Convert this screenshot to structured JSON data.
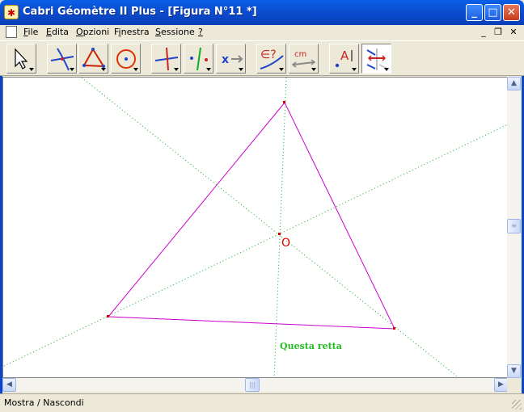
{
  "window": {
    "title": "Cabri Géomètre II Plus - [Figura N°11 *]",
    "app_icon": "cabri-icon",
    "controls": {
      "minimize": "_",
      "maximize": "□",
      "close": "✕"
    }
  },
  "menu": {
    "items": [
      {
        "label": "File",
        "underline": "F"
      },
      {
        "label": "Edita",
        "underline": "E"
      },
      {
        "label": "Opzioni",
        "underline": "O"
      },
      {
        "label": "Finestra",
        "underline": "i"
      },
      {
        "label": "Sessione",
        "underline": "S"
      },
      {
        "label": "?",
        "underline": "?"
      }
    ],
    "mdi_controls": {
      "minimize": "_",
      "restore": "❐",
      "close": "✕"
    }
  },
  "toolbar": {
    "tools": [
      {
        "icon": "pointer-icon"
      },
      {
        "icon": "lines-icon"
      },
      {
        "icon": "triangle-icon"
      },
      {
        "icon": "circle-icon"
      },
      {
        "icon": "perpendicular-icon"
      },
      {
        "icon": "symmetry-icon"
      },
      {
        "icon": "transform-icon"
      },
      {
        "icon": "check-property-icon"
      },
      {
        "icon": "measure-icon",
        "text": "cm"
      },
      {
        "icon": "label-icon",
        "text": "A"
      },
      {
        "icon": "show-hide-icon",
        "active": true
      }
    ],
    "check_text": "∈?"
  },
  "canvas": {
    "point_label": "O",
    "tooltip": "Questa retta",
    "colors": {
      "triangle": "#cc00cc",
      "dotted_lines": "#11aa22",
      "points": "#cc0000",
      "tooltip": "#22bb22"
    }
  },
  "status": {
    "text": "Mostra / Nascondi"
  }
}
